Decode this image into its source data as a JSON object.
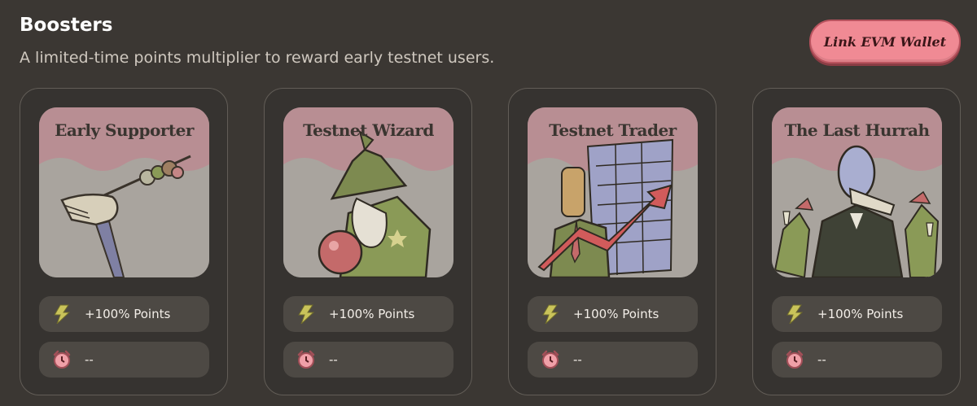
{
  "header": {
    "title": "Boosters",
    "subtitle": "A limited-time points multiplier to reward early testnet users.",
    "wallet_button": "Link EVM Wallet"
  },
  "colors": {
    "background": "#3b3733",
    "card_bg": "#363330",
    "stat_bg": "#4d4944",
    "accent_pink": "#f08a94",
    "bolt_yellow": "#c9c35a",
    "clock_pink": "#f0a0a8"
  },
  "cards": [
    {
      "title": "Early Supporter",
      "points": "+100% Points",
      "timer": "--",
      "illustration": "skewer-hand-art"
    },
    {
      "title": "Testnet Wizard",
      "points": "+100% Points",
      "timer": "--",
      "illustration": "wizard-art"
    },
    {
      "title": "Testnet Trader",
      "points": "+100% Points",
      "timer": "--",
      "illustration": "trader-art"
    },
    {
      "title": "The Last Hurrah",
      "points": "+100% Points",
      "timer": "--",
      "illustration": "party-art"
    }
  ]
}
